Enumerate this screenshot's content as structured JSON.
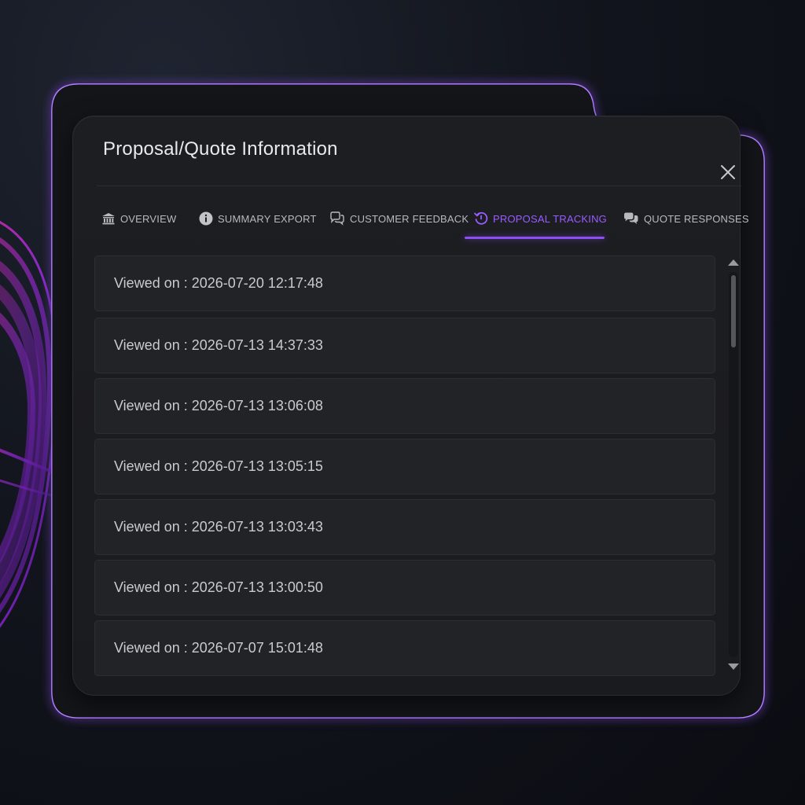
{
  "dialog": {
    "title": "Proposal/Quote Information",
    "close_icon": "close-icon"
  },
  "tabs": [
    {
      "id": "overview",
      "label": "OVERVIEW",
      "icon": "bank-icon"
    },
    {
      "id": "summary-export",
      "label": "SUMMARY EXPORT",
      "icon": "info-icon"
    },
    {
      "id": "customer-feedback",
      "label": "CUSTOMER FEEDBACK",
      "icon": "chat-bubbles-icon"
    },
    {
      "id": "proposal-tracking",
      "label": "PROPOSAL TRACKING",
      "icon": "history-icon",
      "active": true
    },
    {
      "id": "quote-responses",
      "label": "QUOTE RESPONSES",
      "icon": "comments-icon"
    }
  ],
  "views": {
    "prefix": "Viewed on",
    "separator": " : ",
    "items": [
      "2026-07-20 12:17:48",
      "2026-07-13 14:37:33",
      "2026-07-13 13:06:08",
      "2026-07-13 13:05:15",
      "2026-07-13 13:03:43",
      "2026-07-13 13:00:50",
      "2026-07-07 15:01:48"
    ]
  },
  "scrollbar": {
    "position_fraction": 0.0
  },
  "colors": {
    "accent": "#8f4df5",
    "active_tab_text": "#9a5cff",
    "frame_glow": "#9b5cff",
    "panel_bg": "#1d1e22",
    "row_bg": "#222326",
    "text": "#c9cacf"
  }
}
